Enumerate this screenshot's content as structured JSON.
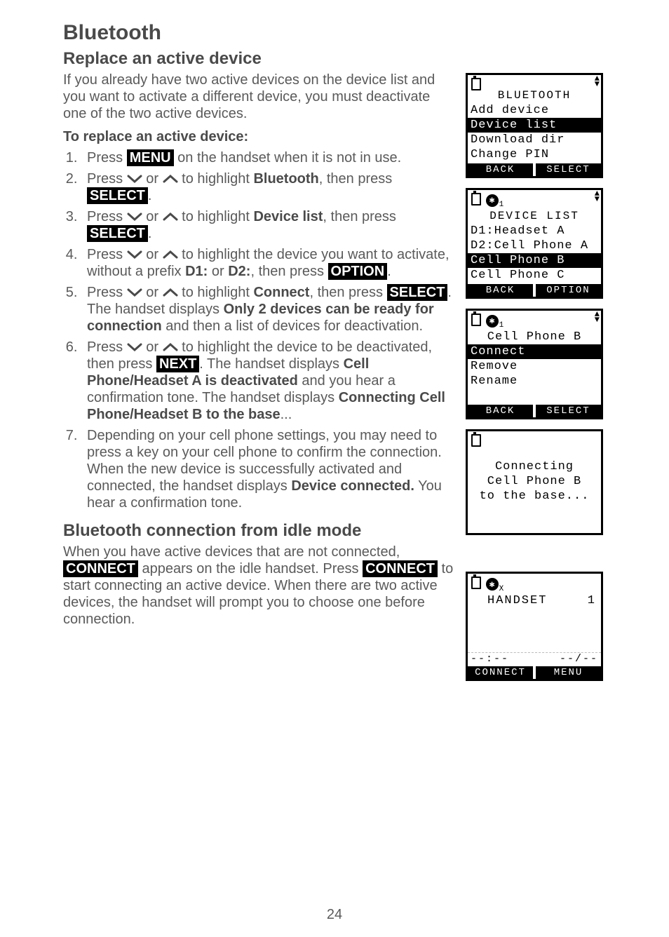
{
  "page": {
    "title": "Bluetooth",
    "footer_page_number": "24",
    "section_a": {
      "heading": "Replace an active device",
      "intro": "If you already have two active devices on the device list and you want to activate a different device, you must deactivate one of the two active devices.",
      "sub_bold": "To replace an active device:",
      "steps": {
        "s1": {
          "pre": "Press ",
          "menu": "MENU",
          "post": " on the handset when it is not in use."
        },
        "s2": {
          "pre": "Press ",
          "mid": " or ",
          "mid2": " to highlight ",
          "hl": "Bluetooth",
          "then": ", then press ",
          "select": "SELECT",
          "end": "."
        },
        "s3": {
          "pre": "Press ",
          "mid": " or ",
          "mid2": " to highlight ",
          "hl": "Device list",
          "then": ", then press ",
          "select": "SELECT",
          "end": "."
        },
        "s4": {
          "pre": "Press ",
          "mid": " or ",
          "mid2": " to highlight the device you want to activate, without a prefix ",
          "d1": "D1:",
          "or": " or ",
          "d2": "D2:",
          "then": ", then press ",
          "option": "OPTION",
          "end": "."
        },
        "s5": {
          "pre": "Press ",
          "mid": " or ",
          "mid2": " to highlight ",
          "hl": "Connect",
          "then": ", then press ",
          "select": "SELECT",
          "sentence2a": ". The handset displays ",
          "msg1": "Only 2 devices can be ready for connection",
          "sentence2b": " and then a list of devices for deactivation."
        },
        "s6": {
          "pre": "Press ",
          "mid": " or ",
          "mid2": " to highlight the device to be deactivated, then press ",
          "next": "NEXT",
          "post1": ". The handset displays ",
          "msg1": "Cell Phone/Headset A is deactivated",
          "post2": " and you hear a confirmation tone. The handset displays ",
          "msg2": "Connecting Cell Phone/Headset B to the base",
          "post3": "..."
        },
        "s7": {
          "text_a": "Depending on your cell phone settings, you may need to press a key on your cell phone to confirm the connection. When the new device is successfully activated and connected, the handset displays ",
          "msg": "Device connected.",
          "text_b": " You hear a confirmation tone."
        }
      }
    },
    "section_b": {
      "heading": "Bluetooth connection from idle mode",
      "para_a": "When you have active devices that are not connected, ",
      "connect1": "CONNECT",
      "para_b": " appears on the idle handset. Press ",
      "connect2": "CONNECT",
      "para_c": " to start connecting an active device. When there are two active devices, the handset will prompt you to choose one before connection."
    }
  },
  "lcd1": {
    "title": "BLUETOOTH",
    "l1": "Add device",
    "l2": "Device list",
    "l3": "Download dir",
    "l4": "Change PIN",
    "sk_left": "BACK",
    "sk_right": "SELECT"
  },
  "lcd2": {
    "badge": "✱",
    "badge_sub": "1",
    "title": "DEVICE LIST",
    "l1": "D1:Headset A",
    "l2": "D2:Cell Phone A",
    "l3": "Cell Phone B",
    "l4": "Cell Phone C",
    "sk_left": "BACK",
    "sk_right": "OPTION"
  },
  "lcd3": {
    "badge": "✱",
    "badge_sub": "1",
    "title": "Cell Phone B",
    "l1": "Connect",
    "l2": "Remove",
    "l3": "Rename",
    "sk_left": "BACK",
    "sk_right": "SELECT"
  },
  "lcd4": {
    "line1": "Connecting",
    "line2": "Cell Phone B",
    "line3": "to the base..."
  },
  "lcd5": {
    "badge": "✱",
    "badge_sub": "X",
    "title": "HANDSET",
    "num": "1",
    "date": "--:--",
    "time": "--/--",
    "sk_left": "CONNECT",
    "sk_right": "MENU"
  }
}
